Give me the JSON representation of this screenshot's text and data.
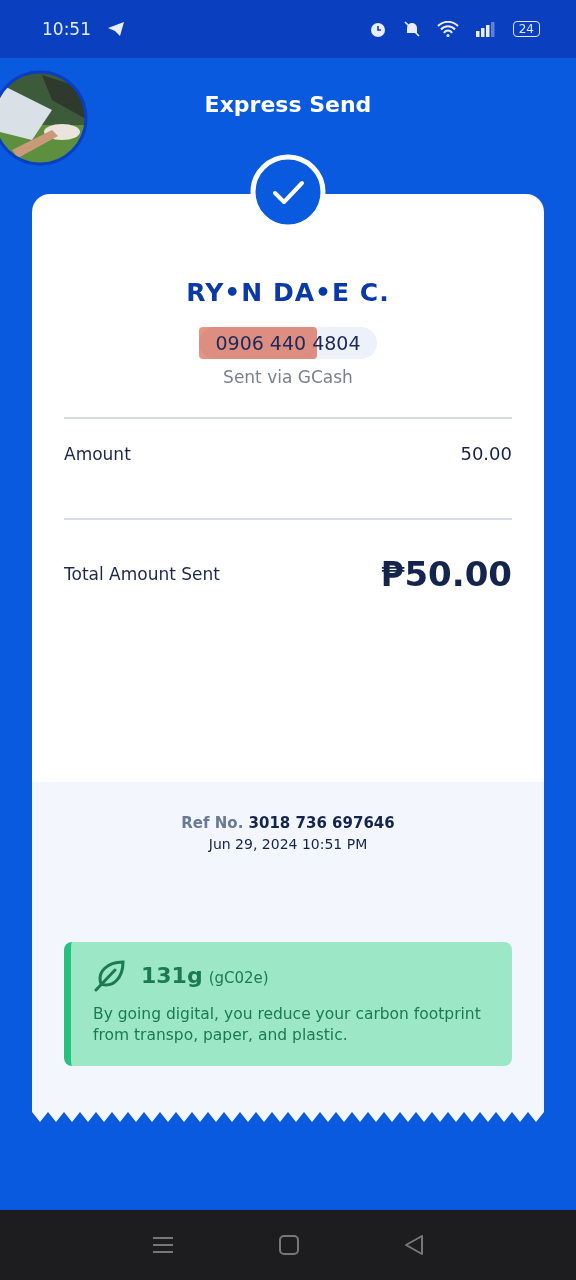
{
  "status_bar": {
    "time": "10:51",
    "battery": "24"
  },
  "header": {
    "title": "Express Send"
  },
  "recipient": {
    "name": "RY•N DA•E C.",
    "phone": "0906 440 4804",
    "via": "Sent via GCash"
  },
  "rows": [
    {
      "label": "Amount",
      "value": "50.00",
      "kind": "plain"
    },
    {
      "label": "Total Amount Sent",
      "value": "₱50.00",
      "kind": "total"
    }
  ],
  "reference": {
    "label": "Ref No.",
    "number": "3018 736 697646",
    "date": "Jun 29, 2024 10:51 PM"
  },
  "carbon": {
    "amount": "131g",
    "unit": "(gC02e)",
    "message": "By going digital, you reduce your carbon footprint from transpo, paper, and plastic."
  }
}
